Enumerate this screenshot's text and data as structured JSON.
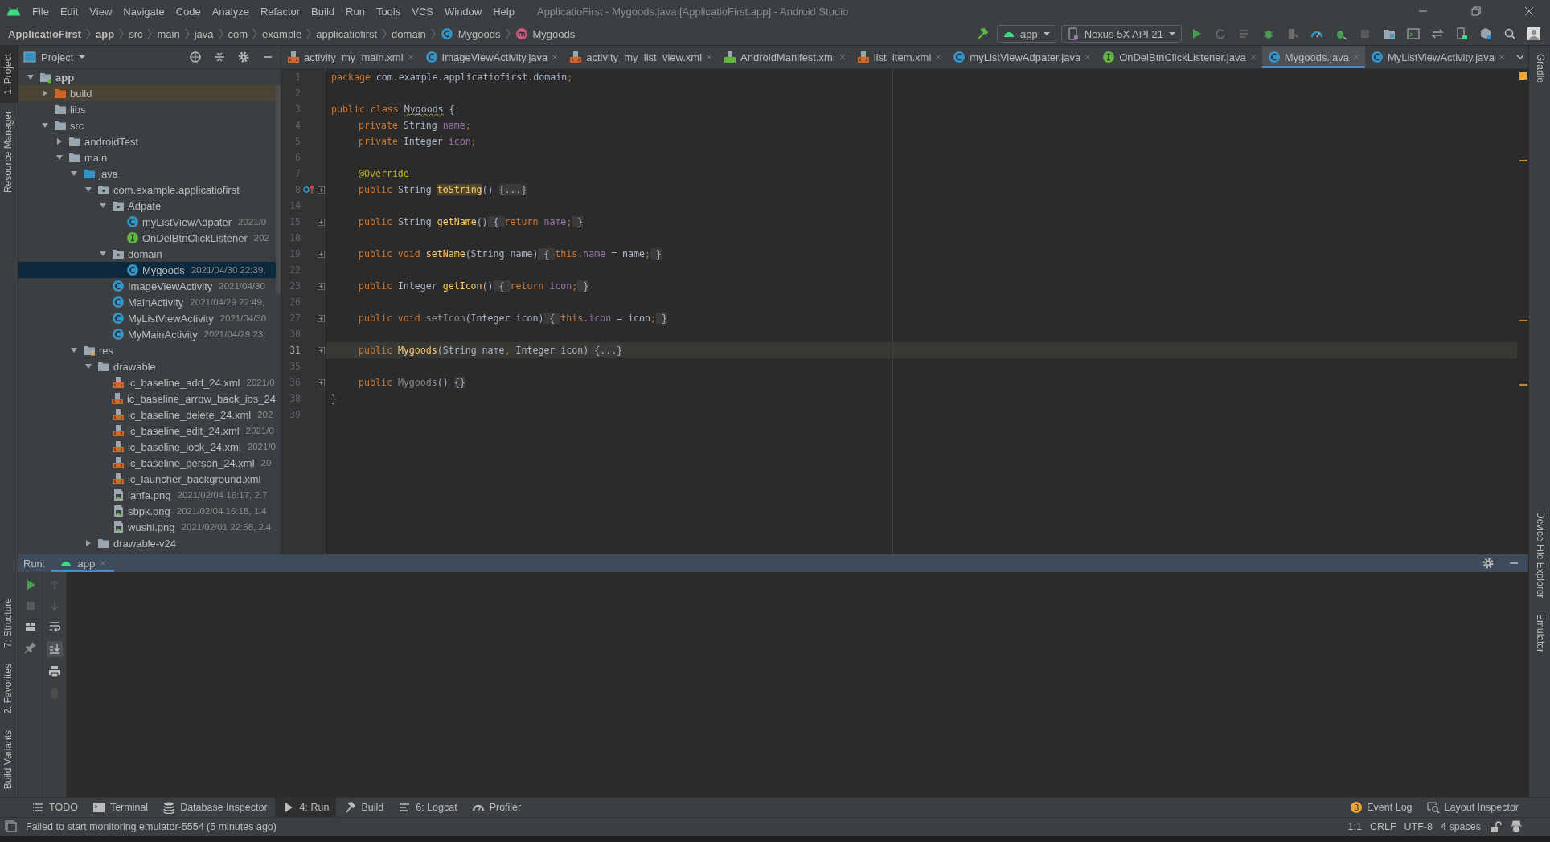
{
  "menu_bar": {
    "items": [
      "File",
      "Edit",
      "View",
      "Navigate",
      "Code",
      "Analyze",
      "Refactor",
      "Build",
      "Run",
      "Tools",
      "VCS",
      "Window",
      "Help"
    ],
    "title": "ApplicatioFirst - Mygoods.java [ApplicatioFirst.app] - Android Studio"
  },
  "navigation_bar": {
    "breadcrumbs": [
      {
        "label": "ApplicatioFirst",
        "kind": "bold"
      },
      {
        "label": "app",
        "kind": "bold"
      },
      {
        "label": "src",
        "kind": "plain"
      },
      {
        "label": "main",
        "kind": "plain"
      },
      {
        "label": "java",
        "kind": "plain"
      },
      {
        "label": "com",
        "kind": "plain"
      },
      {
        "label": "example",
        "kind": "plain"
      },
      {
        "label": "applicatiofirst",
        "kind": "plain"
      },
      {
        "label": "domain",
        "kind": "plain"
      },
      {
        "label": "Mygoods",
        "kind": "class"
      },
      {
        "label": "Mygoods",
        "kind": "method"
      }
    ],
    "run_config": "app",
    "device": "Nexus 5X API 21"
  },
  "left_tool_stripe": {
    "top": [
      {
        "label": "1: Project",
        "selected": true
      },
      {
        "label": "Resource Manager",
        "selected": false
      }
    ],
    "bottom": [
      {
        "label": "7: Structure",
        "selected": false
      },
      {
        "label": "2: Favorites",
        "selected": false
      },
      {
        "label": "Build Variants",
        "selected": false
      }
    ]
  },
  "right_tool_stripe": {
    "top": [
      "Gradle"
    ],
    "bottom": [
      "Device File Explorer",
      "Emulator"
    ]
  },
  "project_panel": {
    "title": "Project",
    "tree": [
      {
        "name": "app",
        "kind": "module",
        "expanded": true,
        "selected": false,
        "children": [
          {
            "name": "build",
            "kind": "excluded",
            "expanded": false,
            "selected": false
          },
          {
            "name": "libs",
            "kind": "folder",
            "selected": false
          },
          {
            "name": "src",
            "kind": "folder",
            "expanded": true,
            "selected": false,
            "children": [
              {
                "name": "androidTest",
                "kind": "folder",
                "expanded": false,
                "selected": false
              },
              {
                "name": "main",
                "kind": "folder",
                "expanded": true,
                "selected": false,
                "children": [
                  {
                    "name": "java",
                    "kind": "source",
                    "expanded": true,
                    "selected": false,
                    "children": [
                      {
                        "name": "com.example.applicatiofirst",
                        "kind": "package",
                        "expanded": true,
                        "selected": false,
                        "children": [
                          {
                            "name": "Adpate",
                            "kind": "package",
                            "expanded": true,
                            "selected": false,
                            "children": [
                              {
                                "name": "myListViewAdpater",
                                "kind": "class",
                                "date": "2021/0",
                                "selected": false
                              },
                              {
                                "name": "OnDelBtnClickListener",
                                "kind": "interface",
                                "date": "202",
                                "selected": false
                              }
                            ]
                          },
                          {
                            "name": "domain",
                            "kind": "package",
                            "expanded": true,
                            "selected": false,
                            "children": [
                              {
                                "name": "Mygoods",
                                "kind": "class",
                                "date": "2021/04/30 22:39,",
                                "selected": true
                              }
                            ]
                          },
                          {
                            "name": "ImageViewActivity",
                            "kind": "class",
                            "date": "2021/04/30",
                            "selected": false
                          },
                          {
                            "name": "MainActivity",
                            "kind": "class",
                            "date": "2021/04/29 22:49,",
                            "selected": false
                          },
                          {
                            "name": "MyListViewActivity",
                            "kind": "class",
                            "date": "2021/04/30",
                            "selected": false
                          },
                          {
                            "name": "MyMainActivity",
                            "kind": "class",
                            "date": "2021/04/29 23:",
                            "selected": false
                          }
                        ]
                      }
                    ]
                  },
                  {
                    "name": "res",
                    "kind": "res",
                    "expanded": true,
                    "selected": false,
                    "children": [
                      {
                        "name": "drawable",
                        "kind": "folder",
                        "expanded": true,
                        "selected": false,
                        "children": [
                          {
                            "name": "ic_baseline_add_24.xml",
                            "kind": "xml",
                            "date": "2021/0",
                            "selected": false
                          },
                          {
                            "name": "ic_baseline_arrow_back_ios_24",
                            "kind": "xml",
                            "selected": false
                          },
                          {
                            "name": "ic_baseline_delete_24.xml",
                            "kind": "xml",
                            "date": "202",
                            "selected": false
                          },
                          {
                            "name": "ic_baseline_edit_24.xml",
                            "kind": "xml",
                            "date": "2021/0",
                            "selected": false
                          },
                          {
                            "name": "ic_baseline_lock_24.xml",
                            "kind": "xml",
                            "date": "2021/0",
                            "selected": false
                          },
                          {
                            "name": "ic_baseline_person_24.xml",
                            "kind": "xml",
                            "date": "20",
                            "selected": false
                          },
                          {
                            "name": "ic_launcher_background.xml",
                            "kind": "xml",
                            "selected": false
                          },
                          {
                            "name": "lanfa.png",
                            "kind": "png",
                            "date": "2021/02/04 16:17, 2.7",
                            "selected": false
                          },
                          {
                            "name": "sbpk.png",
                            "kind": "png",
                            "date": "2021/02/04 16:18, 1.4",
                            "selected": false
                          },
                          {
                            "name": "wushi.png",
                            "kind": "png",
                            "date": "2021/02/01 22:58, 2.4",
                            "selected": false
                          }
                        ]
                      },
                      {
                        "name": "drawable-v24",
                        "kind": "folder",
                        "expanded": false,
                        "selected": false
                      }
                    ]
                  }
                ]
              }
            ]
          }
        ]
      }
    ]
  },
  "editor": {
    "tabs": [
      {
        "label": "activity_my_main.xml",
        "kind": "xml",
        "selected": false
      },
      {
        "label": "ImageViewActivity.java",
        "kind": "class",
        "selected": false
      },
      {
        "label": "activity_my_list_view.xml",
        "kind": "xml",
        "selected": false
      },
      {
        "label": "AndroidManifest.xml",
        "kind": "manifest",
        "selected": false
      },
      {
        "label": "list_item.xml",
        "kind": "xml",
        "selected": false
      },
      {
        "label": "myListViewAdpater.java",
        "kind": "class",
        "selected": false
      },
      {
        "label": "OnDelBtnClickListener.java",
        "kind": "interface",
        "selected": false
      },
      {
        "label": "Mygoods.java",
        "kind": "class",
        "selected": true
      },
      {
        "label": "MyListViewActivity.java",
        "kind": "class",
        "selected": false
      }
    ],
    "lines": [
      {
        "number": "1",
        "indented": false,
        "foldable": false,
        "current": false,
        "tokens": [
          {
            "kind": "kw",
            "text": "package "
          },
          {
            "kind": "plain",
            "text": "com.example.applicatiofirst.domain"
          },
          {
            "kind": "kw",
            "text": ";"
          }
        ]
      },
      {
        "number": "2",
        "foldable": false,
        "current": false
      },
      {
        "number": "3",
        "indented": false,
        "foldable": false,
        "current": false,
        "tokens": [
          {
            "kind": "kw",
            "text": "public class "
          },
          {
            "kind": "typo",
            "text": "Mygoods"
          },
          {
            "kind": "plain",
            "text": " {"
          }
        ]
      },
      {
        "number": "4",
        "indented": true,
        "foldable": false,
        "current": false,
        "tokens": [
          {
            "kind": "kw",
            "text": "private "
          },
          {
            "kind": "plain",
            "text": "String "
          },
          {
            "kind": "field",
            "text": "name"
          },
          {
            "kind": "kw",
            "text": ";"
          }
        ]
      },
      {
        "number": "5",
        "indented": true,
        "foldable": false,
        "current": false,
        "tokens": [
          {
            "kind": "kw",
            "text": "private "
          },
          {
            "kind": "plain",
            "text": "Integer "
          },
          {
            "kind": "field",
            "text": "icon"
          },
          {
            "kind": "kw",
            "text": ";"
          }
        ]
      },
      {
        "number": "6",
        "foldable": false,
        "current": false
      },
      {
        "number": "7",
        "indented": true,
        "foldable": false,
        "current": false,
        "tokens": [
          {
            "kind": "annot",
            "text": "@Override"
          }
        ]
      },
      {
        "number": "8",
        "indented": true,
        "foldable": true,
        "current": false,
        "override": true,
        "tokens": [
          {
            "kind": "kw",
            "text": "public "
          },
          {
            "kind": "plain",
            "text": "String "
          },
          {
            "kind": "match",
            "text": "toString"
          },
          {
            "kind": "plain",
            "text": "() "
          },
          {
            "kind": "fold",
            "text": "{...}"
          }
        ]
      },
      {
        "number": "14",
        "foldable": false,
        "current": false
      },
      {
        "number": "15",
        "indented": true,
        "foldable": true,
        "current": false,
        "tokens": [
          {
            "kind": "kw",
            "text": "public "
          },
          {
            "kind": "plain",
            "text": "String "
          },
          {
            "kind": "method",
            "text": "getName"
          },
          {
            "kind": "plain",
            "text": "()"
          },
          {
            "kind": "fold",
            "text": " { "
          },
          {
            "kind": "kw",
            "text": "return "
          },
          {
            "kind": "field",
            "text": "name"
          },
          {
            "kind": "kw",
            "text": ";"
          },
          {
            "kind": "fold",
            "text": " }"
          }
        ]
      },
      {
        "number": "18",
        "foldable": false,
        "current": false
      },
      {
        "number": "19",
        "indented": true,
        "foldable": true,
        "current": false,
        "tokens": [
          {
            "kind": "kw",
            "text": "public void "
          },
          {
            "kind": "method",
            "text": "setName"
          },
          {
            "kind": "plain",
            "text": "(String name)"
          },
          {
            "kind": "fold",
            "text": " { "
          },
          {
            "kind": "kw",
            "text": "this"
          },
          {
            "kind": "plain",
            "text": "."
          },
          {
            "kind": "field",
            "text": "name"
          },
          {
            "kind": "plain",
            "text": " = name"
          },
          {
            "kind": "kw",
            "text": ";"
          },
          {
            "kind": "fold",
            "text": " }"
          }
        ]
      },
      {
        "number": "22",
        "foldable": false,
        "current": false
      },
      {
        "number": "23",
        "indented": true,
        "foldable": true,
        "current": false,
        "tokens": [
          {
            "kind": "kw",
            "text": "public "
          },
          {
            "kind": "plain",
            "text": "Integer "
          },
          {
            "kind": "method",
            "text": "getIcon"
          },
          {
            "kind": "plain",
            "text": "()"
          },
          {
            "kind": "fold",
            "text": " { "
          },
          {
            "kind": "kw",
            "text": "return "
          },
          {
            "kind": "field",
            "text": "icon"
          },
          {
            "kind": "kw",
            "text": ";"
          },
          {
            "kind": "fold",
            "text": " }"
          }
        ]
      },
      {
        "number": "26",
        "foldable": false,
        "current": false
      },
      {
        "number": "27",
        "indented": true,
        "foldable": true,
        "current": false,
        "tokens": [
          {
            "kind": "kw",
            "text": "public void "
          },
          {
            "kind": "unused",
            "text": "setIcon"
          },
          {
            "kind": "plain",
            "text": "(Integer icon)"
          },
          {
            "kind": "fold",
            "text": " { "
          },
          {
            "kind": "kw",
            "text": "this"
          },
          {
            "kind": "plain",
            "text": "."
          },
          {
            "kind": "field",
            "text": "icon"
          },
          {
            "kind": "plain",
            "text": " = icon"
          },
          {
            "kind": "kw",
            "text": ";"
          },
          {
            "kind": "fold",
            "text": " }"
          }
        ]
      },
      {
        "number": "30",
        "foldable": false,
        "current": false
      },
      {
        "number": "31",
        "indented": true,
        "foldable": true,
        "current": true,
        "tokens": [
          {
            "kind": "kw",
            "text": "public "
          },
          {
            "kind": "method",
            "text": "Mygoods"
          },
          {
            "kind": "plain",
            "text": "(String name"
          },
          {
            "kind": "kw",
            "text": ", "
          },
          {
            "kind": "plain",
            "text": "Integer icon) "
          },
          {
            "kind": "fold",
            "text": "{...}"
          }
        ]
      },
      {
        "number": "35",
        "foldable": false,
        "current": false
      },
      {
        "number": "36",
        "indented": true,
        "foldable": true,
        "current": false,
        "tokens": [
          {
            "kind": "kw",
            "text": "public "
          },
          {
            "kind": "unused",
            "text": "Mygoods"
          },
          {
            "kind": "plain",
            "text": "() "
          },
          {
            "kind": "fold",
            "text": "{}"
          }
        ]
      },
      {
        "number": "38",
        "indented": false,
        "foldable": false,
        "current": false,
        "tokens": [
          {
            "kind": "plain",
            "text": "}"
          }
        ]
      },
      {
        "number": "39",
        "foldable": false,
        "current": false
      }
    ]
  },
  "run_panel": {
    "title": "Run:",
    "tabs": [
      {
        "label": "app",
        "selected": true
      }
    ]
  },
  "tool_window_bar": {
    "left": [
      {
        "label": "TODO",
        "kind": "list",
        "selected": false
      },
      {
        "label": "Terminal",
        "kind": "terminal",
        "selected": false
      },
      {
        "label": "Database Inspector",
        "kind": "database",
        "selected": false
      },
      {
        "label": "4: Run",
        "kind": "run",
        "selected": true
      },
      {
        "label": "Build",
        "kind": "hammer",
        "selected": false
      },
      {
        "label": "6: Logcat",
        "kind": "lines",
        "selected": false
      },
      {
        "label": "Profiler",
        "kind": "gauge",
        "selected": false
      }
    ],
    "right": [
      {
        "label": "Event Log",
        "badge": "3"
      },
      {
        "label": "Layout Inspector"
      }
    ]
  },
  "status_bar": {
    "message": "Failed to start monitoring emulator-5554 (5 minutes ago)",
    "items": [
      "1:1",
      "CRLF",
      "UTF-8",
      "4 spaces"
    ]
  }
}
